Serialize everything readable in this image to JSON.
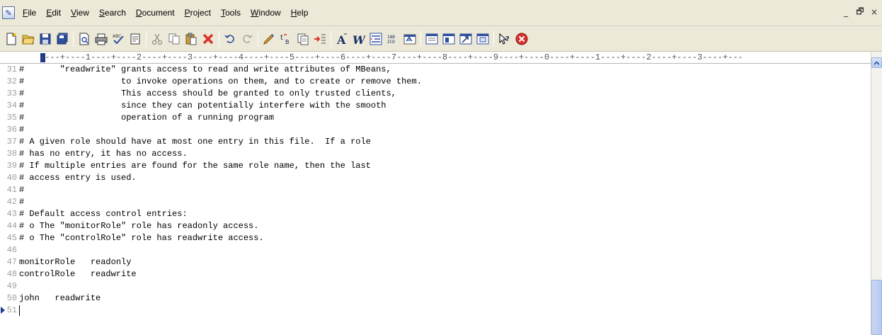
{
  "menubar": {
    "items": [
      {
        "accel": "F",
        "rest": "ile"
      },
      {
        "accel": "E",
        "rest": "dit"
      },
      {
        "accel": "V",
        "rest": "iew"
      },
      {
        "accel": "S",
        "rest": "earch"
      },
      {
        "accel": "D",
        "rest": "ocument"
      },
      {
        "accel": "P",
        "rest": "roject"
      },
      {
        "accel": "T",
        "rest": "ools"
      },
      {
        "accel": "W",
        "rest": "indow"
      },
      {
        "accel": "H",
        "rest": "elp"
      }
    ],
    "window_controls": {
      "minimize": "_",
      "restore": "🗗",
      "close": "×"
    }
  },
  "toolbar": {
    "spell_label": "ABC",
    "abc_label": "1AB\n2CD"
  },
  "ruler": {
    "text": "----+----1----+----2----+----3----+----4----+----5----+----6----+----7----+----8----+----9----+----0----+----1----+----2----+----3----+---"
  },
  "editor": {
    "lines": [
      {
        "num": "31",
        "text": "#       \"readwrite\" grants access to read and write attributes of MBeans,"
      },
      {
        "num": "32",
        "text": "#                   to invoke operations on them, and to create or remove them."
      },
      {
        "num": "33",
        "text": "#                   This access should be granted to only trusted clients,"
      },
      {
        "num": "34",
        "text": "#                   since they can potentially interfere with the smooth"
      },
      {
        "num": "35",
        "text": "#                   operation of a running program"
      },
      {
        "num": "36",
        "text": "#"
      },
      {
        "num": "37",
        "text": "# A given role should have at most one entry in this file.  If a role"
      },
      {
        "num": "38",
        "text": "# has no entry, it has no access."
      },
      {
        "num": "39",
        "text": "# If multiple entries are found for the same role name, then the last"
      },
      {
        "num": "40",
        "text": "# access entry is used."
      },
      {
        "num": "41",
        "text": "#"
      },
      {
        "num": "42",
        "text": "#"
      },
      {
        "num": "43",
        "text": "# Default access control entries:"
      },
      {
        "num": "44",
        "text": "# o The \"monitorRole\" role has readonly access."
      },
      {
        "num": "45",
        "text": "# o The \"controlRole\" role has readwrite access."
      },
      {
        "num": "46",
        "text": ""
      },
      {
        "num": "47",
        "text": "monitorRole   readonly"
      },
      {
        "num": "48",
        "text": "controlRole   readwrite"
      },
      {
        "num": "49",
        "text": ""
      },
      {
        "num": "50",
        "text": "john   readwrite"
      },
      {
        "num": "51",
        "text": ""
      }
    ]
  },
  "colors": {
    "chrome": "#ece9d8",
    "ruler_cursor": "#1f3a8a",
    "line_numbers": "#a0a0a0",
    "close_red": "#d9322c"
  }
}
